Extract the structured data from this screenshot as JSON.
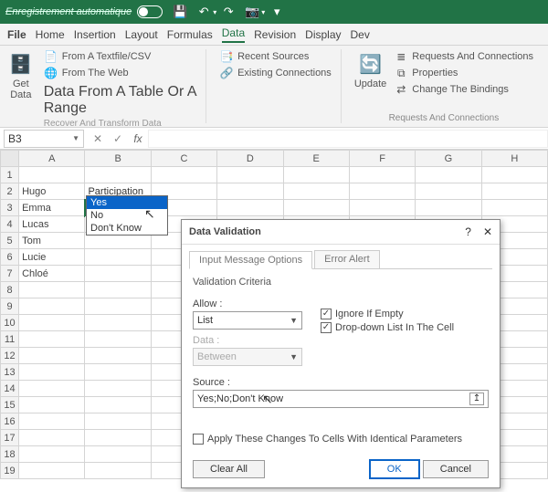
{
  "titlebar": {
    "autosave_label": "Enregistrement automatique",
    "icons": {
      "save": "💾",
      "undo": "↶",
      "redo": "↷",
      "camera": "📷",
      "more": "▾"
    }
  },
  "menu": {
    "file": "File",
    "items": [
      "Home",
      "Insertion",
      "Layout",
      "Formulas",
      "Data",
      "Revision",
      "Display",
      "Dev"
    ]
  },
  "ribbon": {
    "group1": {
      "get_data": "Get Data",
      "from_csv": "From A Textfile/CSV",
      "from_web": "From The Web",
      "from_table": "Data From A Table Or A Range",
      "subtitle": "Recover And Transform Data"
    },
    "group2": {
      "recent": "Recent Sources",
      "existing": "Existing Connections"
    },
    "group3": {
      "update": "Update",
      "requests": "Requests And Connections",
      "properties": "Properties",
      "change": "Change The Bindings",
      "label": "Requests And Connections"
    }
  },
  "formula_bar": {
    "namebox": "B3",
    "fx": "fx"
  },
  "sheet": {
    "columns": [
      "A",
      "B",
      "C",
      "D",
      "E",
      "F",
      "G",
      "H"
    ],
    "rows": [
      {
        "n": 1,
        "a": "",
        "b": ""
      },
      {
        "n": 2,
        "a": "Hugo",
        "b": "Participation"
      },
      {
        "n": 3,
        "a": "Emma",
        "b": ""
      },
      {
        "n": 4,
        "a": "Lucas",
        "b": ""
      },
      {
        "n": 5,
        "a": "Tom",
        "b": ""
      },
      {
        "n": 6,
        "a": "Lucie",
        "b": ""
      },
      {
        "n": 7,
        "a": "Chloé",
        "b": ""
      },
      {
        "n": 8,
        "a": "",
        "b": ""
      },
      {
        "n": 9,
        "a": "",
        "b": ""
      },
      {
        "n": 10,
        "a": "",
        "b": ""
      },
      {
        "n": 11,
        "a": "",
        "b": ""
      },
      {
        "n": 12,
        "a": "",
        "b": ""
      },
      {
        "n": 13,
        "a": "",
        "b": ""
      },
      {
        "n": 14,
        "a": "",
        "b": ""
      },
      {
        "n": 15,
        "a": "",
        "b": ""
      },
      {
        "n": 16,
        "a": "",
        "b": ""
      },
      {
        "n": 17,
        "a": "",
        "b": ""
      },
      {
        "n": 18,
        "a": "",
        "b": ""
      },
      {
        "n": 19,
        "a": "",
        "b": ""
      }
    ]
  },
  "dropdown": {
    "items": [
      "Yes",
      "No",
      "Don't Know"
    ]
  },
  "dialog": {
    "title": "Data Validation",
    "tabs": {
      "options": "Input Message  Options",
      "error": "Error Alert"
    },
    "section": "Validation Criteria",
    "allow_label": "Allow :",
    "allow_value": "List",
    "ignore_blank": "Ignore If Empty",
    "in_cell": "Drop-down List In The Cell",
    "data_label": "Data :",
    "data_value": "Between",
    "source_label": "Source :",
    "source_value": "Yes;No;Don't Know",
    "apply_same": "Apply These Changes To Cells With Identical Parameters",
    "clear": "Clear All",
    "ok": "OK",
    "cancel": "Cancel"
  }
}
